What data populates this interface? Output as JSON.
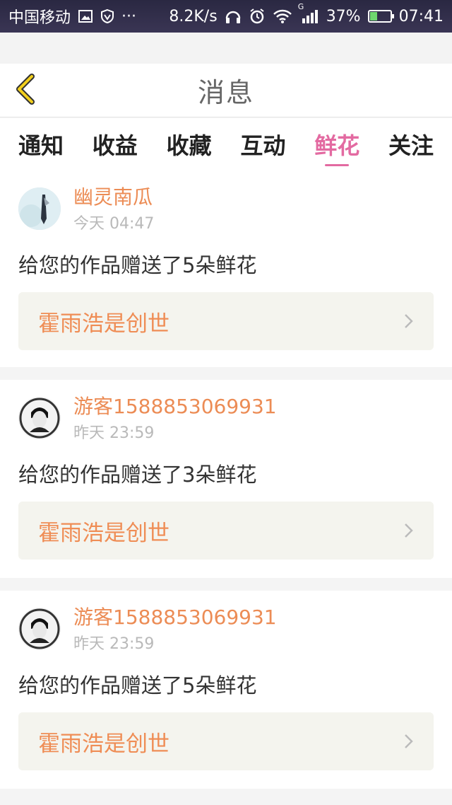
{
  "status_bar": {
    "carrier": "中国移动",
    "more": "···",
    "network_speed": "8.2K/s",
    "signal_type": "G",
    "battery": "37%",
    "battery_level": 0.37,
    "time": "07:41"
  },
  "header": {
    "title": "消息"
  },
  "tabs": [
    {
      "label": "通知",
      "active": false
    },
    {
      "label": "收益",
      "active": false
    },
    {
      "label": "收藏",
      "active": false
    },
    {
      "label": "互动",
      "active": false
    },
    {
      "label": "鲜花",
      "active": true
    },
    {
      "label": "关注",
      "active": false
    }
  ],
  "messages": [
    {
      "username": "幽灵南瓜",
      "time": "今天 04:47",
      "text": "给您的作品赠送了5朵鲜花",
      "work_title": "霍雨浩是创世"
    },
    {
      "username": "游客1588853069931",
      "time": "昨天 23:59",
      "text": "给您的作品赠送了3朵鲜花",
      "work_title": "霍雨浩是创世"
    },
    {
      "username": "游客1588853069931",
      "time": "昨天 23:59",
      "text": "给您的作品赠送了5朵鲜花",
      "work_title": "霍雨浩是创世"
    }
  ],
  "colors": {
    "accent_pink": "#e36aa1",
    "username_orange": "#ec8c55",
    "work_orange": "#ef8d55",
    "status_bar_bg": "#2a2842"
  },
  "icons": {
    "back": "chevron-left-icon",
    "work_link": "chevron-right-icon"
  }
}
